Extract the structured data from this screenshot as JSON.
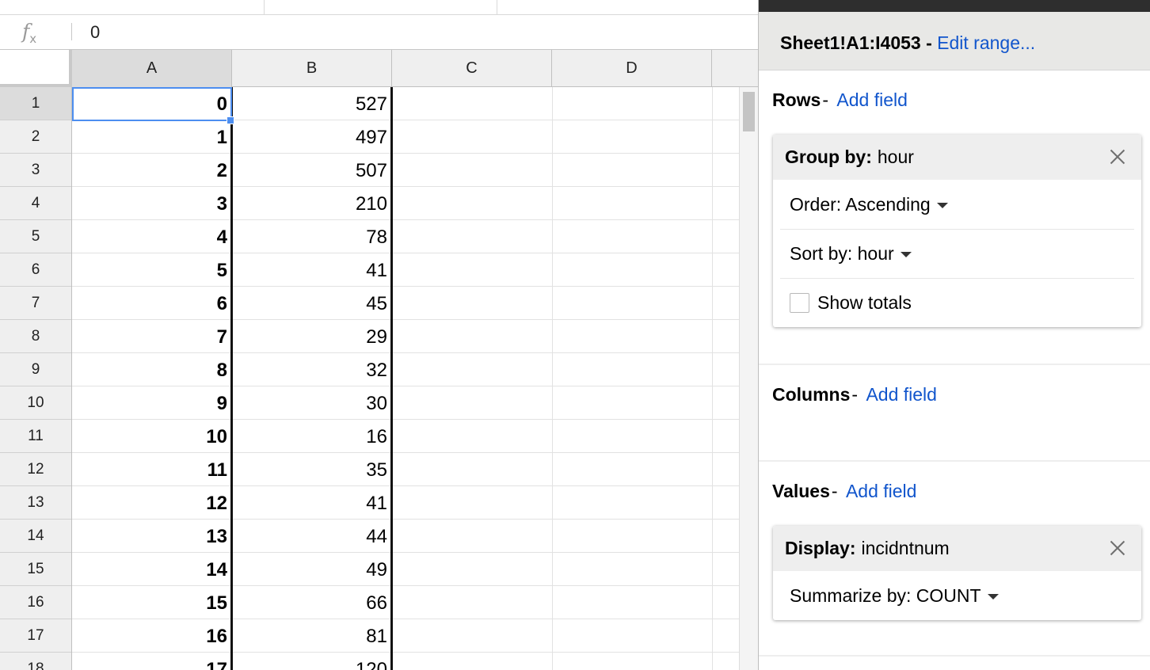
{
  "formula_bar": {
    "icon": "fx-icon",
    "value": "0"
  },
  "columns": [
    "A",
    "B",
    "C",
    "D"
  ],
  "rows": [
    {
      "n": "1",
      "a": "0",
      "b": "527"
    },
    {
      "n": "2",
      "a": "1",
      "b": "497"
    },
    {
      "n": "3",
      "a": "2",
      "b": "507"
    },
    {
      "n": "4",
      "a": "3",
      "b": "210"
    },
    {
      "n": "5",
      "a": "4",
      "b": "78"
    },
    {
      "n": "6",
      "a": "5",
      "b": "41"
    },
    {
      "n": "7",
      "a": "6",
      "b": "45"
    },
    {
      "n": "8",
      "a": "7",
      "b": "29"
    },
    {
      "n": "9",
      "a": "8",
      "b": "32"
    },
    {
      "n": "10",
      "a": "9",
      "b": "30"
    },
    {
      "n": "11",
      "a": "10",
      "b": "16"
    },
    {
      "n": "12",
      "a": "11",
      "b": "35"
    },
    {
      "n": "13",
      "a": "12",
      "b": "41"
    },
    {
      "n": "14",
      "a": "13",
      "b": "44"
    },
    {
      "n": "15",
      "a": "14",
      "b": "49"
    },
    {
      "n": "16",
      "a": "15",
      "b": "66"
    },
    {
      "n": "17",
      "a": "16",
      "b": "81"
    },
    {
      "n": "18",
      "a": "17",
      "b": "120"
    }
  ],
  "selection": {
    "cell": "A1"
  },
  "pivot": {
    "range": {
      "text": "Sheet1!A1:I4053 -",
      "edit_link": "Edit range..."
    },
    "rows_section": {
      "title": "Rows",
      "dash": "-",
      "add_field": "Add field",
      "group": {
        "label": "Group by:",
        "field": "hour",
        "order": "Order: Ascending",
        "sort": "Sort by: hour",
        "show_totals": "Show totals",
        "show_totals_checked": false
      }
    },
    "columns_section": {
      "title": "Columns",
      "dash": "-",
      "add_field": "Add field"
    },
    "values_section": {
      "title": "Values",
      "dash": "-",
      "add_field": "Add field",
      "display": {
        "label": "Display:",
        "field": "incidntnum",
        "summarize": "Summarize by: COUNT"
      }
    }
  },
  "colors": {
    "accent_link": "#1155cc",
    "selection": "#4d8ef0",
    "header_bg": "#efefef",
    "panel_header_bg": "#e8e8e6"
  }
}
